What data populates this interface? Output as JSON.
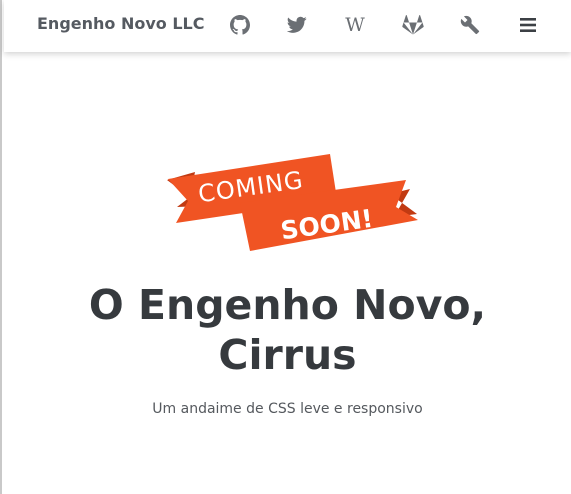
{
  "navbar": {
    "brand": "Engenho Novo LLC",
    "icons": [
      "github-icon",
      "twitter-icon",
      "wikipedia-icon",
      "gitlab-icon",
      "wrench-icon",
      "menu-icon"
    ],
    "icon_color": "#6b6f74"
  },
  "hero": {
    "badge_line1": "COMING",
    "badge_line2": "SOON!",
    "title_line1": "O Engenho Novo,",
    "title_line2": "Cirrus",
    "subtitle": "Um andaime de CSS leve e responsivo"
  },
  "colors": {
    "ribbon": "#f05423",
    "ribbon_dark": "#c13a12",
    "ribbon_fold": "#f6b192",
    "heading": "#363a3e",
    "brand": "#555a61"
  }
}
